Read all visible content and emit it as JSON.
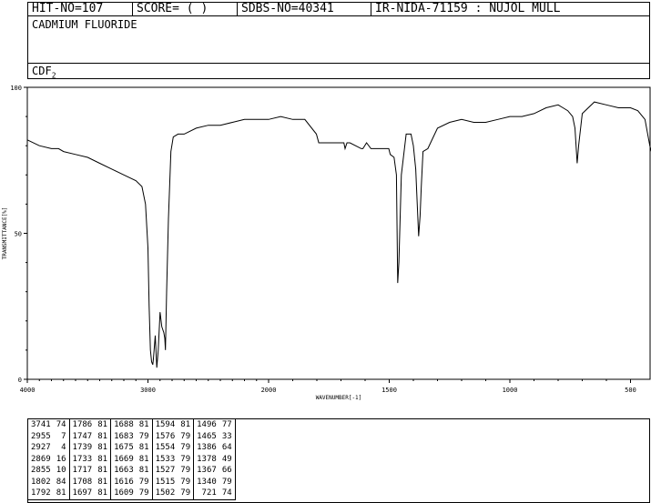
{
  "header": {
    "hit_no": "HIT-NO=107",
    "score": "SCORE=  (   )",
    "sdbs_no": "SDBS-NO=40341",
    "ir_code": "IR-NIDA-71159 : NUJOL MULL"
  },
  "compound_name": "CADMIUM FLUORIDE",
  "formula_base": "CDF",
  "formula_sub": "2",
  "chart_data": {
    "type": "line",
    "xlabel": "WAVENUMBER[-1]",
    "ylabel": "TRANSMITTANCE[%]",
    "xlim": [
      4000,
      400
    ],
    "ylim": [
      0,
      100
    ],
    "x_ticks": [
      "4000",
      "3000",
      "2000",
      "1500",
      "1000",
      "500"
    ],
    "x_tick_values": [
      4000,
      3000,
      2000,
      1500,
      1000,
      500
    ],
    "y_ticks": [
      "0",
      "50",
      "100"
    ],
    "y_tick_values": [
      0,
      50,
      100
    ],
    "series": [
      {
        "x": [
          4000,
          3900,
          3800,
          3741,
          3700,
          3600,
          3500,
          3400,
          3300,
          3200,
          3100,
          3050,
          3020,
          3000,
          2990,
          2980,
          2970,
          2960,
          2955,
          2940,
          2927,
          2915,
          2900,
          2885,
          2869,
          2860,
          2855,
          2845,
          2830,
          2810,
          2790,
          2750,
          2700,
          2600,
          2500,
          2400,
          2300,
          2200,
          2100,
          2000,
          1950,
          1900,
          1850,
          1802,
          1792,
          1786,
          1747,
          1739,
          1733,
          1717,
          1708,
          1697,
          1688,
          1683,
          1675,
          1669,
          1663,
          1616,
          1609,
          1594,
          1576,
          1554,
          1533,
          1527,
          1515,
          1502,
          1496,
          1480,
          1470,
          1465,
          1460,
          1450,
          1430,
          1410,
          1400,
          1390,
          1386,
          1378,
          1372,
          1367,
          1360,
          1340,
          1300,
          1250,
          1200,
          1150,
          1100,
          1050,
          1000,
          950,
          900,
          850,
          800,
          780,
          760,
          740,
          730,
          721,
          715,
          700,
          650,
          600,
          550,
          500,
          470,
          440,
          420,
          400
        ],
        "y": [
          82,
          80,
          79,
          79,
          78,
          77,
          76,
          74,
          72,
          70,
          68,
          66,
          60,
          45,
          25,
          10,
          6,
          5,
          7,
          15,
          4,
          10,
          23,
          18,
          16,
          14,
          10,
          30,
          55,
          78,
          83,
          84,
          84,
          86,
          87,
          87,
          88,
          89,
          89,
          89,
          90,
          89,
          89,
          84,
          81,
          81,
          81,
          81,
          81,
          81,
          81,
          81,
          81,
          79,
          81,
          81,
          81,
          79,
          79,
          81,
          79,
          79,
          79,
          79,
          79,
          79,
          77,
          76,
          70,
          33,
          40,
          70,
          84,
          84,
          80,
          72,
          64,
          49,
          56,
          66,
          78,
          79,
          86,
          88,
          89,
          88,
          88,
          89,
          90,
          90,
          91,
          93,
          94,
          93,
          92,
          90,
          86,
          74,
          80,
          91,
          95,
          94,
          93,
          93,
          92,
          89,
          80,
          74
        ]
      }
    ],
    "peak_table": [
      [
        "3741",
        "74"
      ],
      [
        "2955",
        "7"
      ],
      [
        "2927",
        "4"
      ],
      [
        "2869",
        "16"
      ],
      [
        "2855",
        "10"
      ],
      [
        "1802",
        "84"
      ],
      [
        "1792",
        "81"
      ],
      [
        "1786",
        "81"
      ],
      [
        "1747",
        "81"
      ],
      [
        "1739",
        "81"
      ],
      [
        "1733",
        "81"
      ],
      [
        "1717",
        "81"
      ],
      [
        "1708",
        "81"
      ],
      [
        "1697",
        "81"
      ],
      [
        "1688",
        "81"
      ],
      [
        "1683",
        "79"
      ],
      [
        "1675",
        "81"
      ],
      [
        "1669",
        "81"
      ],
      [
        "1663",
        "81"
      ],
      [
        "1616",
        "79"
      ],
      [
        "1609",
        "79"
      ],
      [
        "1594",
        "81"
      ],
      [
        "1576",
        "79"
      ],
      [
        "1554",
        "79"
      ],
      [
        "1533",
        "79"
      ],
      [
        "1527",
        "79"
      ],
      [
        "1515",
        "79"
      ],
      [
        "1502",
        "79"
      ],
      [
        "1496",
        "77"
      ],
      [
        "1465",
        "33"
      ],
      [
        "1386",
        "64"
      ],
      [
        "1378",
        "49"
      ],
      [
        "1367",
        "66"
      ],
      [
        "1340",
        "79"
      ],
      [
        "721",
        "74"
      ]
    ]
  },
  "colors": {
    "line": "#000000",
    "background": "#ffffff"
  }
}
